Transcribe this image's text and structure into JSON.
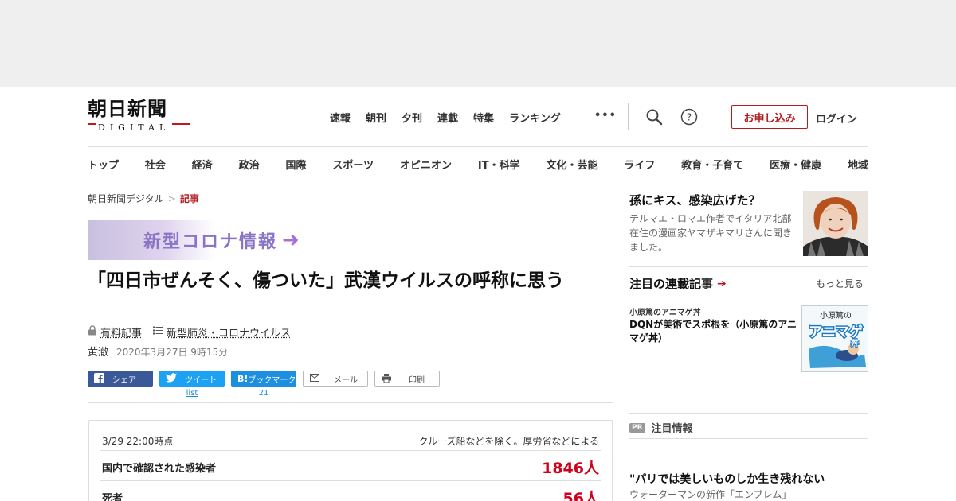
{
  "header": {
    "logo_main": "朝日新聞",
    "logo_sub": "DIGITAL",
    "top_nav": [
      "速報",
      "朝刊",
      "夕刊",
      "連載",
      "特集",
      "ランキング"
    ],
    "more_label": "•••",
    "apply_label": "お申し込み",
    "login_label": "ログイン",
    "search_icon": "search-icon",
    "help_icon": "help-icon"
  },
  "category_nav": [
    "トップ",
    "社会",
    "経済",
    "政治",
    "国際",
    "スポーツ",
    "オピニオン",
    "IT・科学",
    "文化・芸能",
    "ライフ",
    "教育・子育て",
    "医療・健康",
    "地域"
  ],
  "breadcrumb": {
    "home": "朝日新聞デジタル",
    "separator": ">",
    "current": "記事"
  },
  "banner": {
    "text": "新型コロナ情報",
    "arrow": "➜"
  },
  "article": {
    "headline": "「四日市ぜんそく、傷ついた」武漢ウイルスの呼称に思う",
    "paid_label": "有料記事",
    "topic_label": "新型肺炎・コロナウイルス",
    "author": "黄澈",
    "date": "2020年3月27日 9時15分"
  },
  "share": {
    "facebook": "シェア",
    "twitter": "ツイート",
    "twitter_count": "list",
    "hatena": "ブックマーク",
    "hatena_prefix": "B!",
    "hatena_count": "21",
    "mail": "メール",
    "print": "印刷"
  },
  "stats": {
    "timestamp": "3/29 22:00時点",
    "note": "クルーズ船などを除く。厚労省などによる",
    "rows": [
      {
        "label": "国内で確認された感染者",
        "value": "1846人"
      },
      {
        "label": "死者",
        "value": "56人"
      }
    ]
  },
  "sidebar": {
    "feature": {
      "title": "孫にキス、感染広げた？",
      "desc": "テルマエ・ロマエ作者でイタリア北部在住の漫画家ヤマザキマリさんに聞きました。"
    },
    "rensai": {
      "heading": "注目の連載記事",
      "more": "もっと見る",
      "item_label": "小原篤のアニマゲ丼",
      "item_title": "DQNが美術でスポ根を（小原篤のアニマゲ丼）",
      "thumb_top": "小原篤の",
      "thumb_main": "アニマゲ",
      "thumb_sub": "丼"
    },
    "pr": {
      "badge": "PR",
      "label": "注目情報",
      "title": "\"パリでは美しいものしか生き残れない",
      "sub": "ウォーターマンの新作「エンブレム」"
    }
  },
  "colors": {
    "brand_red": "#b51a1f",
    "stat_red": "#d0021b",
    "facebook": "#3b5998",
    "twitter": "#1da1f2",
    "hatena": "#1d8fe0",
    "banner_purple": "#8a74c6"
  }
}
